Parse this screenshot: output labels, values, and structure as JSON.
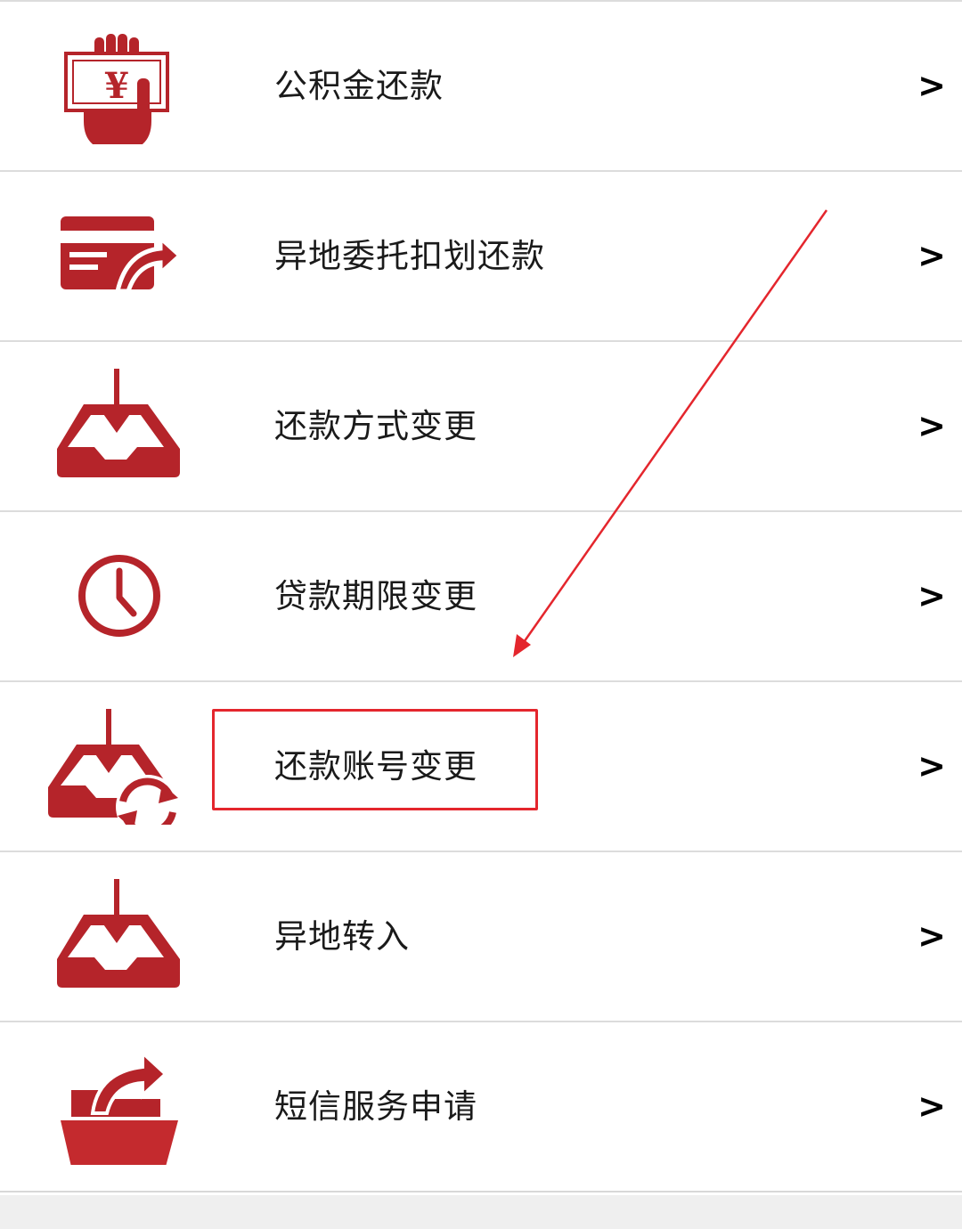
{
  "menu": {
    "items": [
      {
        "label": "公积金还款",
        "chevron": ">",
        "icon": "hand-money-icon"
      },
      {
        "label": "异地委托扣划还款",
        "chevron": ">",
        "icon": "card-transfer-icon"
      },
      {
        "label": "还款方式变更",
        "chevron": ">",
        "icon": "inbox-download-icon"
      },
      {
        "label": "贷款期限变更",
        "chevron": ">",
        "icon": "clock-icon"
      },
      {
        "label": "还款账号变更",
        "chevron": ">",
        "icon": "inbox-sync-icon"
      },
      {
        "label": "异地转入",
        "chevron": ">",
        "icon": "inbox-download-icon"
      },
      {
        "label": "短信服务申请",
        "chevron": ">",
        "icon": "folder-share-icon"
      }
    ]
  },
  "icon_glyphs": {
    "currency": "¥"
  },
  "colors": {
    "icon_red": "#b5242a",
    "annotation_red": "#e4262d",
    "divider": "#dcdcdc",
    "text": "#1a1a1a"
  },
  "annotation": {
    "highlighted_item": "还款账号变更"
  }
}
